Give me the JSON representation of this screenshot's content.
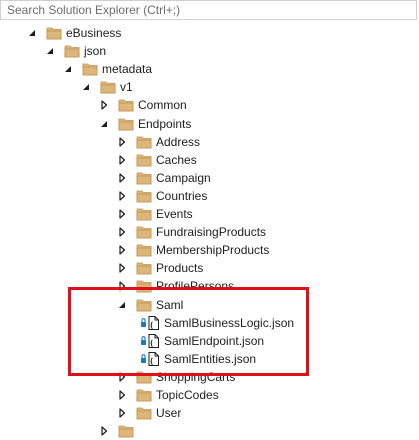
{
  "search": {
    "placeholder": "Search Solution Explorer (Ctrl+;)"
  },
  "tree": [
    {
      "label": "eBusiness",
      "depth": 0,
      "state": "expanded",
      "kind": "folder"
    },
    {
      "label": "json",
      "depth": 1,
      "state": "expanded",
      "kind": "folder"
    },
    {
      "label": "metadata",
      "depth": 2,
      "state": "expanded",
      "kind": "folder"
    },
    {
      "label": "v1",
      "depth": 3,
      "state": "expanded",
      "kind": "folder"
    },
    {
      "label": "Common",
      "depth": 4,
      "state": "collapsed",
      "kind": "folder"
    },
    {
      "label": "Endpoints",
      "depth": 4,
      "state": "expanded",
      "kind": "folder"
    },
    {
      "label": "Address",
      "depth": 5,
      "state": "collapsed",
      "kind": "folder"
    },
    {
      "label": "Caches",
      "depth": 5,
      "state": "collapsed",
      "kind": "folder"
    },
    {
      "label": "Campaign",
      "depth": 5,
      "state": "collapsed",
      "kind": "folder"
    },
    {
      "label": "Countries",
      "depth": 5,
      "state": "collapsed",
      "kind": "folder"
    },
    {
      "label": "Events",
      "depth": 5,
      "state": "collapsed",
      "kind": "folder"
    },
    {
      "label": "FundraisingProducts",
      "depth": 5,
      "state": "collapsed",
      "kind": "folder"
    },
    {
      "label": "MembershipProducts",
      "depth": 5,
      "state": "collapsed",
      "kind": "folder"
    },
    {
      "label": "Products",
      "depth": 5,
      "state": "collapsed",
      "kind": "folder"
    },
    {
      "label": "ProfilePersons",
      "depth": 5,
      "state": "collapsed",
      "kind": "folder"
    },
    {
      "label": "Saml",
      "depth": 5,
      "state": "expanded",
      "kind": "folder"
    },
    {
      "label": "SamlBusinessLogic.json",
      "depth": 6,
      "state": "none",
      "kind": "file"
    },
    {
      "label": "SamlEndpoint.json",
      "depth": 6,
      "state": "none",
      "kind": "file"
    },
    {
      "label": "SamlEntities.json",
      "depth": 6,
      "state": "none",
      "kind": "file"
    },
    {
      "label": "ShoppingCarts",
      "depth": 5,
      "state": "collapsed",
      "kind": "folder"
    },
    {
      "label": "TopicCodes",
      "depth": 5,
      "state": "collapsed",
      "kind": "folder"
    },
    {
      "label": "User",
      "depth": 5,
      "state": "collapsed",
      "kind": "folder"
    },
    {
      "label": "",
      "depth": 4,
      "state": "collapsed",
      "kind": "folder"
    }
  ],
  "colors": {
    "folder": "#dcb67a",
    "folder_dark": "#c09553",
    "arrow": "#1e1e1e",
    "highlight": "#e0101a",
    "lock": "#1c78c0",
    "file": "#1e1e1e"
  }
}
